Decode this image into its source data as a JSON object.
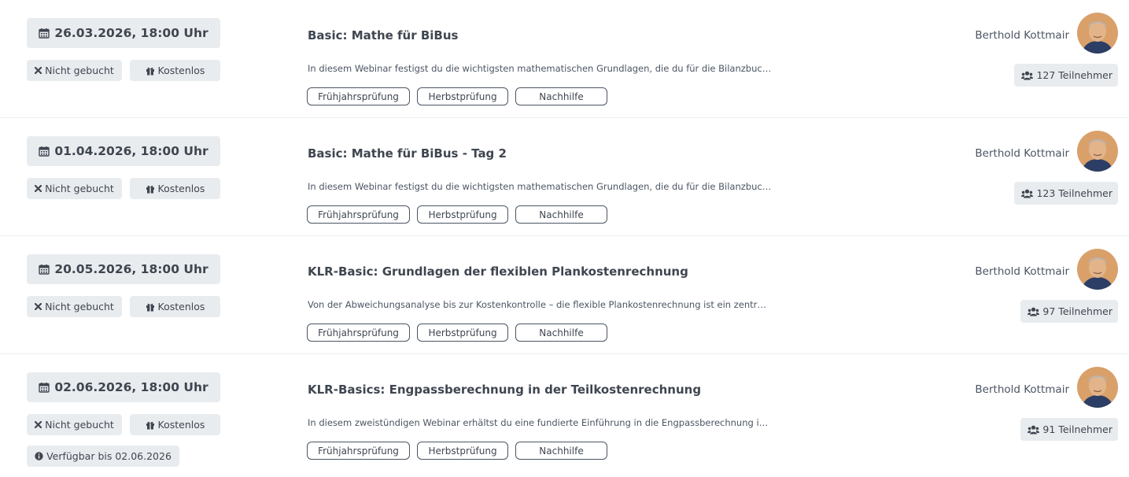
{
  "events": [
    {
      "date": "26.03.2026, 18:00 Uhr",
      "booking_status": "Nicht gebucht",
      "price": "Kostenlos",
      "title": "Basic: Mathe für BiBus",
      "description": "In diesem Webinar festigst du die wichtigsten mathematischen Grundlagen, die du für die Bilanzbuc…",
      "tags": [
        "Frühjahrsprüfung",
        "Herbstprüfung",
        "Nachhilfe"
      ],
      "instructor": "Berthold Kottmair",
      "participants": "127 Teilnehmer"
    },
    {
      "date": "01.04.2026, 18:00 Uhr",
      "booking_status": "Nicht gebucht",
      "price": "Kostenlos",
      "title": "Basic: Mathe für BiBus - Tag 2",
      "description": "In diesem Webinar festigst du die wichtigsten mathematischen Grundlagen, die du für die Bilanzbuc…",
      "tags": [
        "Frühjahrsprüfung",
        "Herbstprüfung",
        "Nachhilfe"
      ],
      "instructor": "Berthold Kottmair",
      "participants": "123 Teilnehmer"
    },
    {
      "date": "20.05.2026, 18:00 Uhr",
      "booking_status": "Nicht gebucht",
      "price": "Kostenlos",
      "title": "KLR-Basic: Grundlagen der flexiblen Plankostenrechnung",
      "description": "Von der Abweichungsanalyse bis zur Kostenkontrolle – die flexible Plankostenrechnung ist ein zentr…",
      "tags": [
        "Frühjahrsprüfung",
        "Herbstprüfung",
        "Nachhilfe"
      ],
      "instructor": "Berthold Kottmair",
      "participants": "97 Teilnehmer"
    },
    {
      "date": "02.06.2026, 18:00 Uhr",
      "booking_status": "Nicht gebucht",
      "price": "Kostenlos",
      "availability": "Verfügbar bis 02.06.2026",
      "title": "KLR-Basics: Engpassberechnung in der Teilkostenrechnung",
      "description": "In diesem zweistündigen Webinar erhältst du eine fundierte Einführung in die Engpassberechnung i…",
      "tags": [
        "Frühjahrsprüfung",
        "Herbstprüfung",
        "Nachhilfe"
      ],
      "instructor": "Berthold Kottmair",
      "participants": "91 Teilnehmer"
    }
  ],
  "icons": {
    "date": "calendar-icon",
    "booking_status": "times-icon",
    "price": "gift-icon",
    "availability": "info-circle-icon",
    "participants": "users-icon",
    "instructor": "avatar"
  },
  "colors": {
    "chip_bg": "#e9ecef",
    "text_dark": "#3f4650",
    "text_muted": "#4b5563",
    "divider": "#eceef1"
  }
}
